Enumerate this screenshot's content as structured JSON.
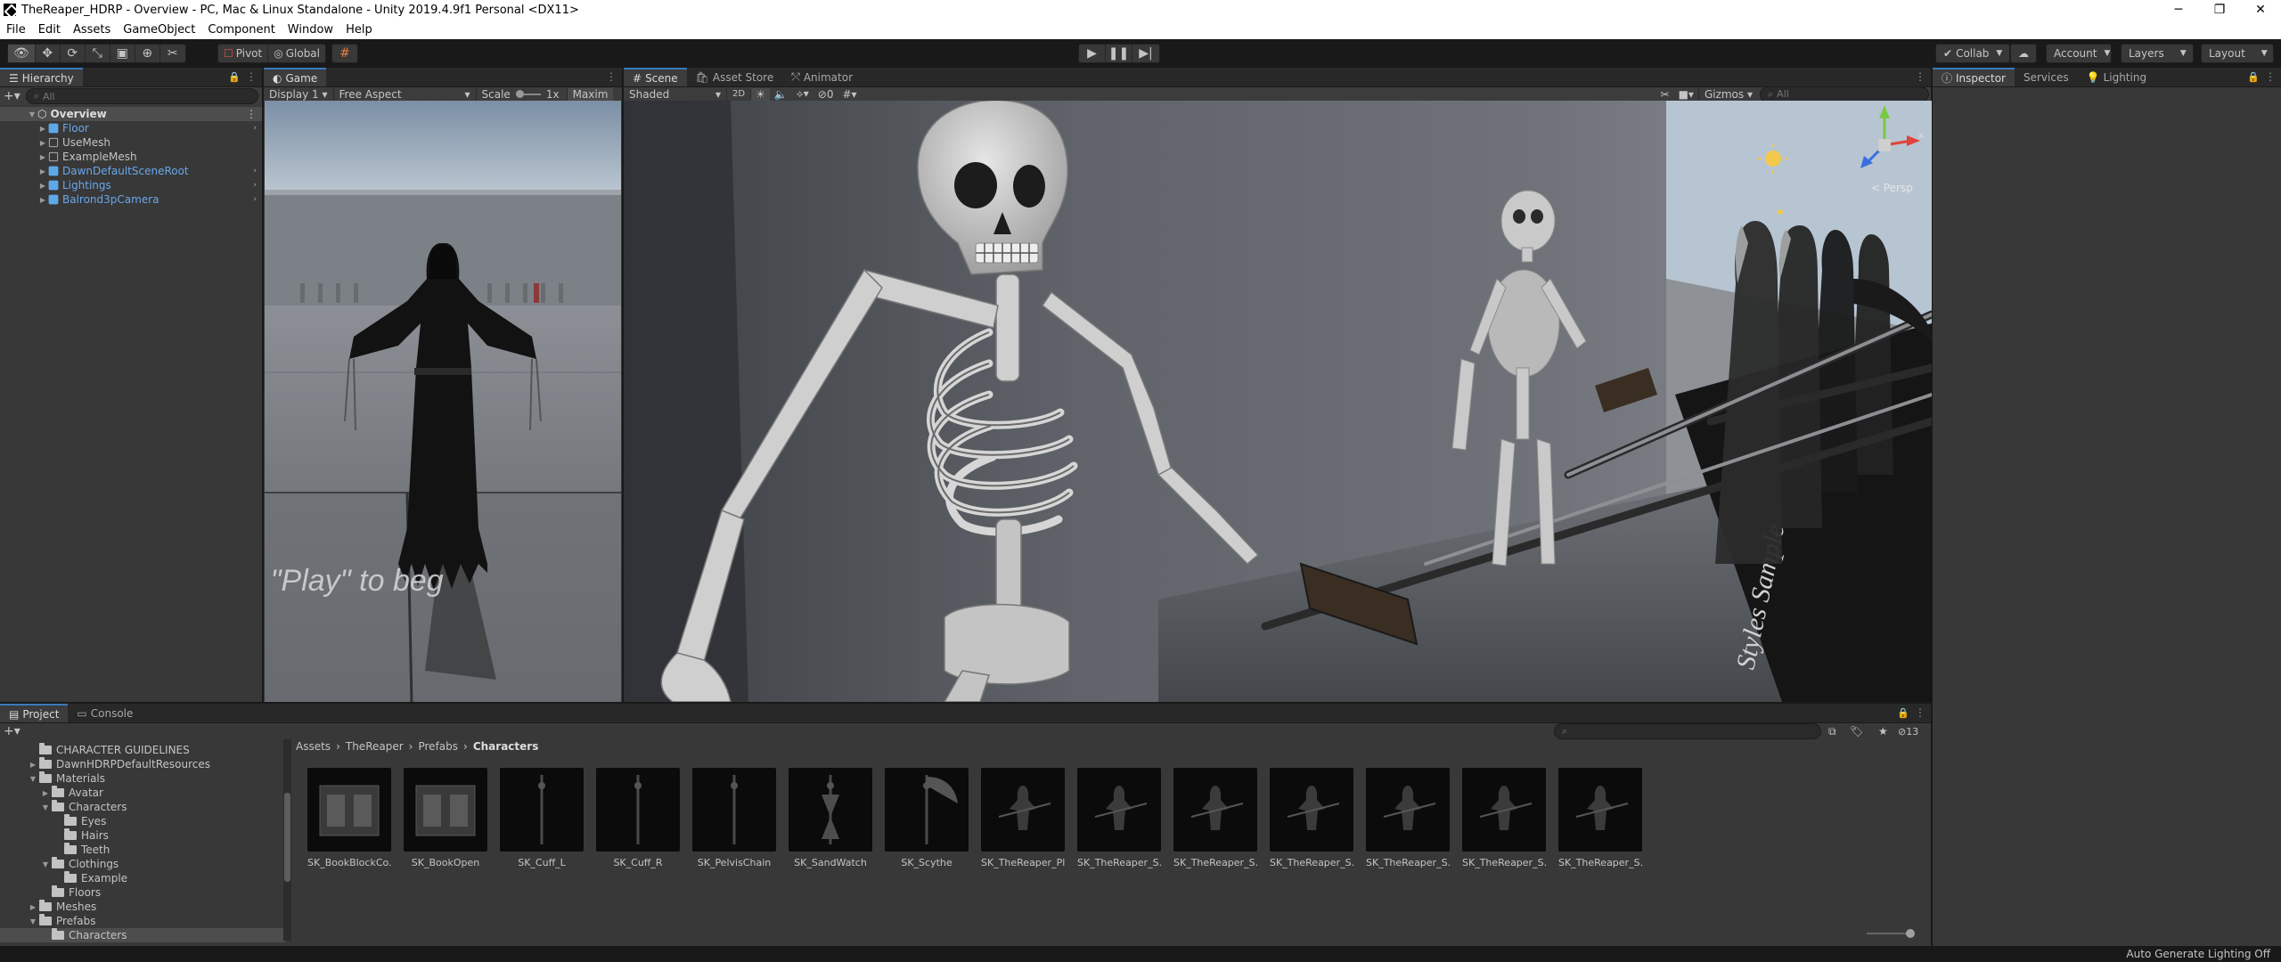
{
  "window": {
    "title": "TheReaper_HDRP - Overview - PC, Mac & Linux Standalone - Unity 2019.4.9f1 Personal <DX11>",
    "controls": [
      "─",
      "❐",
      "✕"
    ]
  },
  "menu": [
    "File",
    "Edit",
    "Assets",
    "GameObject",
    "Component",
    "Window",
    "Help"
  ],
  "toolbar": {
    "pivot": "Pivot",
    "global": "Global",
    "collab": "Collab",
    "account": "Account",
    "layers": "Layers",
    "layout": "Layout"
  },
  "hierarchy": {
    "tab": "Hierarchy",
    "search_placeholder": "All",
    "scene": "Overview",
    "items": [
      {
        "name": "Floor",
        "prefab": true,
        "arrow": true
      },
      {
        "name": "UseMesh",
        "prefab": false,
        "arrow": false
      },
      {
        "name": "ExampleMesh",
        "prefab": false,
        "arrow": false
      },
      {
        "name": "DawnDefaultSceneRoot",
        "prefab": true,
        "arrow": true
      },
      {
        "name": "Lightings",
        "prefab": true,
        "arrow": true
      },
      {
        "name": "Balrond3pCamera",
        "prefab": true,
        "arrow": true
      }
    ]
  },
  "game": {
    "tab": "Game",
    "display": "Display 1",
    "aspect": "Free Aspect",
    "scale_label": "Scale",
    "scale_value": "1x",
    "maximize": "Maxim",
    "overlay_text": "k \"Play\" to beg"
  },
  "scene": {
    "tabs": [
      "Scene",
      "Asset Store",
      "Animator"
    ],
    "shading": "Shaded",
    "mode2d": "2D",
    "fx_count": "0",
    "gizmos": "Gizmos",
    "search_placeholder": "All",
    "persp": "< Persp",
    "sign_text": "Styles Sample"
  },
  "inspector": {
    "tabs": [
      "Inspector",
      "Services",
      "Lighting"
    ]
  },
  "project": {
    "tabs": [
      "Project",
      "Console"
    ],
    "tree": [
      {
        "label": "CHARACTER GUIDELINES",
        "indent": 1,
        "arrow": ""
      },
      {
        "label": "DawnHDRPDefaultResources",
        "indent": 1,
        "arrow": "▶"
      },
      {
        "label": "Materials",
        "indent": 1,
        "arrow": "▼"
      },
      {
        "label": "Avatar",
        "indent": 2,
        "arrow": "▶"
      },
      {
        "label": "Characters",
        "indent": 2,
        "arrow": "▼"
      },
      {
        "label": "Eyes",
        "indent": 3,
        "arrow": ""
      },
      {
        "label": "Hairs",
        "indent": 3,
        "arrow": ""
      },
      {
        "label": "Teeth",
        "indent": 3,
        "arrow": ""
      },
      {
        "label": "Clothings",
        "indent": 2,
        "arrow": "▼"
      },
      {
        "label": "Example",
        "indent": 3,
        "arrow": ""
      },
      {
        "label": "Floors",
        "indent": 2,
        "arrow": ""
      },
      {
        "label": "Meshes",
        "indent": 1,
        "arrow": "▶"
      },
      {
        "label": "Prefabs",
        "indent": 1,
        "arrow": "▼"
      },
      {
        "label": "Characters",
        "indent": 2,
        "arrow": "",
        "selected": true
      }
    ],
    "breadcrumb": [
      "Assets",
      "TheReaper",
      "Prefabs",
      "Characters"
    ],
    "asset_count": "13",
    "assets": [
      "SK_BookBlockCo...",
      "SK_BookOpen",
      "SK_Cuff_L",
      "SK_Cuff_R",
      "SK_PelvisChain",
      "SK_SandWatch",
      "SK_Scythe",
      "SK_TheReaper_Pl...",
      "SK_TheReaper_S...",
      "SK_TheReaper_S...",
      "SK_TheReaper_S...",
      "SK_TheReaper_S...",
      "SK_TheReaper_S...",
      "SK_TheReaper_S..."
    ]
  },
  "status": {
    "right": "Auto Generate Lighting Off"
  }
}
